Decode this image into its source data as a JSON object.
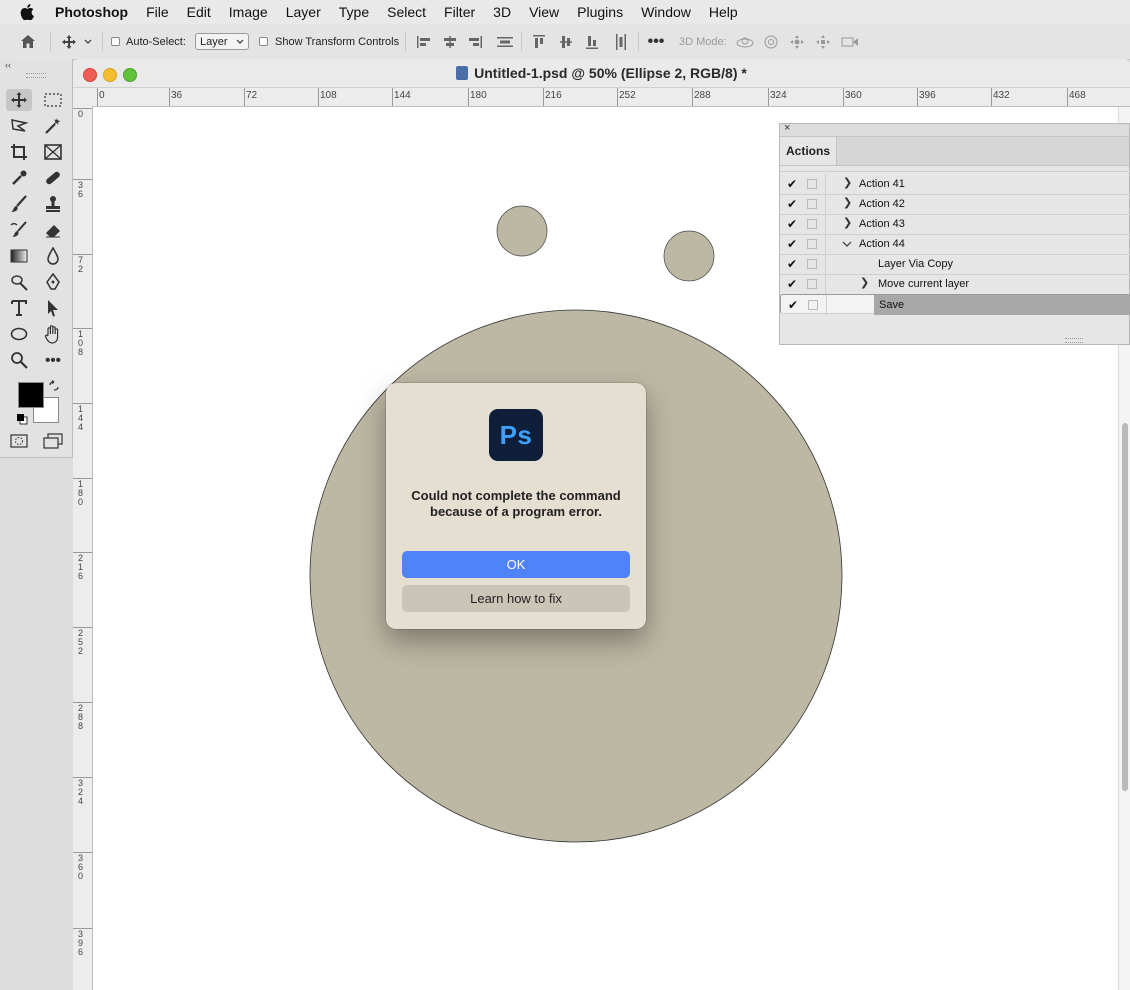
{
  "menubar": {
    "app_name": "Photoshop",
    "items": [
      "File",
      "Edit",
      "Image",
      "Layer",
      "Type",
      "Select",
      "Filter",
      "3D",
      "View",
      "Plugins",
      "Window",
      "Help"
    ]
  },
  "options_bar": {
    "auto_select_label": "Auto-Select:",
    "auto_select_value": "Layer",
    "show_transform_label": "Show Transform Controls",
    "threed_mode_label": "3D Mode:"
  },
  "document": {
    "title": "Untitled-1.psd @ 50% (Ellipse 2, RGB/8) *",
    "ruler_h": [
      "0",
      "36",
      "72",
      "108",
      "144",
      "180",
      "216",
      "252",
      "288",
      "324",
      "360",
      "396",
      "432",
      "468"
    ],
    "ruler_v": [
      "0",
      "36",
      "72",
      "108",
      "144",
      "180",
      "216",
      "252",
      "288",
      "324",
      "360",
      "396"
    ]
  },
  "actions_panel": {
    "tab": "Actions",
    "rows": [
      {
        "label": "Action 41",
        "level": 0,
        "expanded": false,
        "selected": false
      },
      {
        "label": "Action 42",
        "level": 0,
        "expanded": false,
        "selected": false
      },
      {
        "label": "Action 43",
        "level": 0,
        "expanded": false,
        "selected": false
      },
      {
        "label": "Action 44",
        "level": 0,
        "expanded": true,
        "selected": false
      },
      {
        "label": "Layer Via Copy",
        "level": 1,
        "expanded": null,
        "selected": false
      },
      {
        "label": "Move current layer",
        "level": 1,
        "expanded": false,
        "selected": false
      },
      {
        "label": "Save",
        "level": 1,
        "expanded": null,
        "selected": true
      }
    ]
  },
  "dialog": {
    "logo_text": "Ps",
    "message": "Could not complete the command because of a program error.",
    "ok_label": "OK",
    "learn_label": "Learn how to fix"
  },
  "colors": {
    "shape_fill": "#bdb8a3",
    "ok_button": "#4f83f7",
    "dialog_bg": "#e4dfd0"
  }
}
